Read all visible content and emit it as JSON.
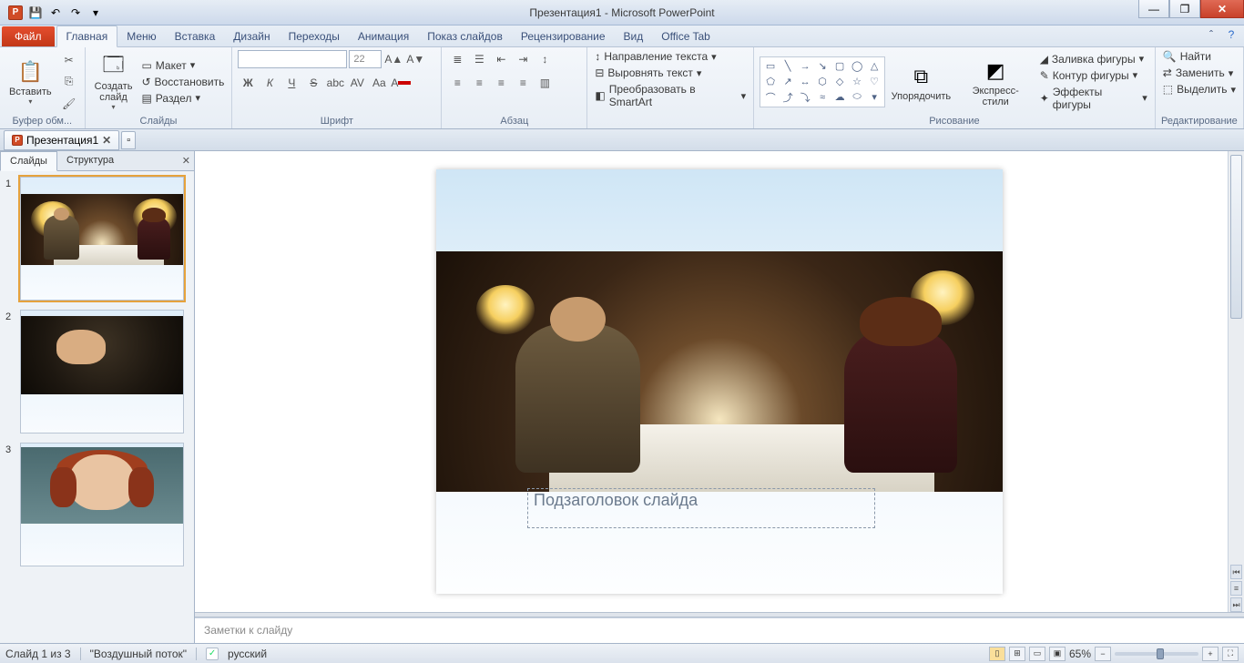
{
  "title": "Презентация1 - Microsoft PowerPoint",
  "qat": {
    "save": "💾",
    "undo": "↶",
    "redo": "↷",
    "more": "▾"
  },
  "win": {
    "min": "—",
    "max": "❐",
    "close": "✕"
  },
  "tabs": {
    "file": "Файл",
    "items": [
      "Главная",
      "Меню",
      "Вставка",
      "Дизайн",
      "Переходы",
      "Анимация",
      "Показ слайдов",
      "Рецензирование",
      "Вид",
      "Office Tab"
    ],
    "active": 0
  },
  "ribbon": {
    "clipboard": {
      "label": "Буфер обм...",
      "paste": "Вставить",
      "cut": "✂",
      "copy": "⎘",
      "painter": "🖌"
    },
    "slides": {
      "label": "Слайды",
      "new": "Создать\nслайд",
      "layout": "Макет",
      "reset": "Восстановить",
      "section": "Раздел"
    },
    "font": {
      "label": "Шрифт",
      "name": "",
      "size": "22",
      "bold": "Ж",
      "italic": "К",
      "under": "Ч",
      "strike": "S",
      "shadow": "abc",
      "spacing": "AV",
      "case": "Aa",
      "clear": "A",
      "color": "A",
      "incf": "A▲",
      "decf": "A▼"
    },
    "para": {
      "label": "Абзац",
      "dir": "Направление текста",
      "align": "Выровнять текст",
      "smart": "Преобразовать в SmartArt"
    },
    "draw": {
      "label": "Рисование",
      "arrange": "Упорядочить",
      "quick": "Экспресс-стили",
      "fill": "Заливка фигуры",
      "outline": "Контур фигуры",
      "effects": "Эффекты фигуры"
    },
    "edit": {
      "label": "Редактирование",
      "find": "Найти",
      "replace": "Заменить",
      "select": "Выделить"
    }
  },
  "doctabs": {
    "name": "Презентация1",
    "close": "✕"
  },
  "panel": {
    "slides": "Слайды",
    "outline": "Структура",
    "close": "✕",
    "active": 0,
    "count": 3
  },
  "slide": {
    "subtitle": "Подзаголовок слайда"
  },
  "notes": "Заметки к слайду",
  "status": {
    "pos": "Слайд 1 из 3",
    "theme": "\"Воздушный поток\"",
    "lang": "русский",
    "zoom": "65%"
  }
}
